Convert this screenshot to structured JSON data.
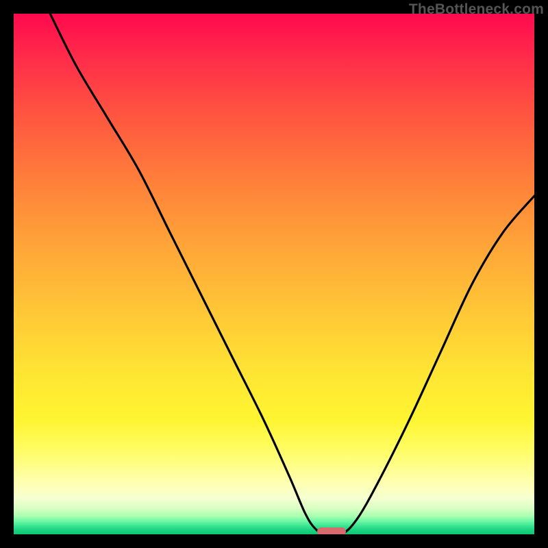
{
  "watermark": "TheBottleneck.com",
  "chart_data": {
    "type": "line",
    "title": "",
    "xlabel": "",
    "ylabel": "",
    "xlim": [
      0,
      100
    ],
    "ylim": [
      0,
      100
    ],
    "grid": false,
    "legend": false,
    "background_gradient": {
      "direction": "vertical",
      "stops": [
        {
          "pos": 0,
          "color": "#ff0a4e"
        },
        {
          "pos": 0.45,
          "color": "#ffa638"
        },
        {
          "pos": 0.78,
          "color": "#fff531"
        },
        {
          "pos": 0.95,
          "color": "#d9ffc4"
        },
        {
          "pos": 1.0,
          "color": "#0ec773"
        }
      ]
    },
    "series": [
      {
        "name": "bottleneck-curve",
        "color": "#000000",
        "x": [
          7,
          12,
          18,
          24,
          30,
          36,
          42,
          48,
          53,
          56,
          58,
          60,
          63,
          66,
          70,
          76,
          82,
          88,
          94,
          100
        ],
        "y": [
          100,
          90,
          80,
          70,
          58,
          46,
          34,
          22,
          11,
          4,
          1,
          0,
          0,
          3,
          10,
          22,
          35,
          48,
          58,
          65
        ]
      }
    ],
    "marker": {
      "name": "optimal-point",
      "x": 61,
      "y": 0,
      "color": "#d76a6d",
      "shape": "rounded-bar"
    }
  }
}
